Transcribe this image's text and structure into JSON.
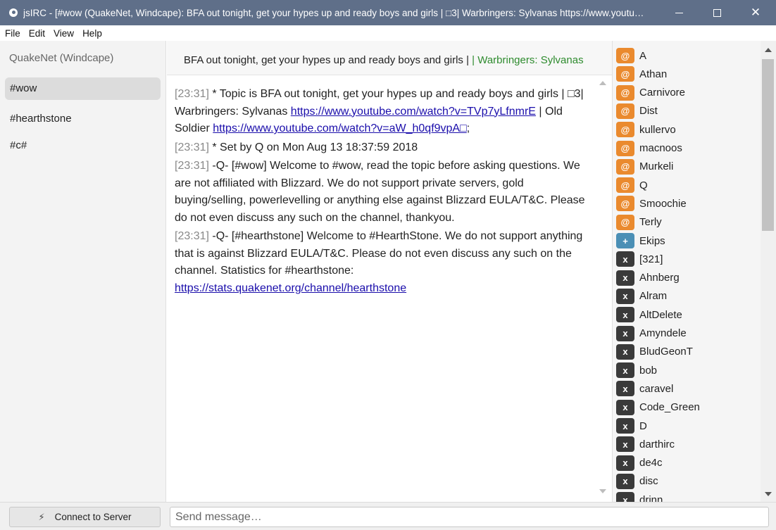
{
  "window": {
    "title": "jsIRC - [#wow (QuakeNet, Windcape): BFA out tonight, get your hypes up and ready boys and girls | □3| Warbringers: Sylvanas https://www.youtu…"
  },
  "menu": [
    "File",
    "Edit",
    "View",
    "Help"
  ],
  "sidebar": {
    "server": "QuakeNet (Windcape)",
    "channels": [
      "#wow",
      "#hearthstone",
      "#c#"
    ]
  },
  "topic": {
    "text": "BFA out tonight, get your hypes up and ready boys and girls |",
    "colored": "| Warbringers: Sylvanas"
  },
  "messages": [
    {
      "time": "[23:31]",
      "text": " * Topic is BFA out tonight, get your hypes up and ready boys and girls | □3| Warbringers: Sylvanas ",
      "link1": "https://www.youtube.com/watch?v=TVp7yLfnmrE",
      "mid": " | Old Soldier ",
      "link2": "https://www.youtube.com/watch?v=aW_h0qf9vpA□",
      "end": ";"
    },
    {
      "time": "[23:31]",
      "text": " * Set by Q on Mon Aug 13 18:37:59 2018"
    },
    {
      "time": "[23:31]",
      "text": " -Q- [#wow] Welcome to #wow, read the topic before asking questions. We are not affiliated with Blizzard. We do not support private servers, gold buying/selling, powerlevelling or anything else against Blizzard EULA/T&C. Please do not even discuss any such on the channel, thankyou."
    },
    {
      "time": "[23:31]",
      "text": " -Q- [#hearthstone] Welcome to #HearthStone. We do not support anything that is against Blizzard EULA/T&C. Please do not even discuss any such on the channel. Statistics for #hearthstone: ",
      "link1": "https://stats.quakenet.org/channel/hearthstone"
    }
  ],
  "users": [
    {
      "prefix": "@",
      "name": "A",
      "type": "op"
    },
    {
      "prefix": "@",
      "name": "Athan",
      "type": "op"
    },
    {
      "prefix": "@",
      "name": "Carnivore",
      "type": "op"
    },
    {
      "prefix": "@",
      "name": "Dist",
      "type": "op"
    },
    {
      "prefix": "@",
      "name": "kullervo",
      "type": "op"
    },
    {
      "prefix": "@",
      "name": "macnoos",
      "type": "op"
    },
    {
      "prefix": "@",
      "name": "Murkeli",
      "type": "op"
    },
    {
      "prefix": "@",
      "name": "Q",
      "type": "op"
    },
    {
      "prefix": "@",
      "name": "Smoochie",
      "type": "op"
    },
    {
      "prefix": "@",
      "name": "Terly",
      "type": "op"
    },
    {
      "prefix": "+",
      "name": "Ekips",
      "type": "voice"
    },
    {
      "prefix": "x",
      "name": "[321]",
      "type": "none"
    },
    {
      "prefix": "x",
      "name": "Ahnberg",
      "type": "none"
    },
    {
      "prefix": "x",
      "name": "Alram",
      "type": "none"
    },
    {
      "prefix": "x",
      "name": "AltDelete",
      "type": "none"
    },
    {
      "prefix": "x",
      "name": "Amyndele",
      "type": "none"
    },
    {
      "prefix": "x",
      "name": "BludGeonT",
      "type": "none"
    },
    {
      "prefix": "x",
      "name": "bob",
      "type": "none"
    },
    {
      "prefix": "x",
      "name": "caravel",
      "type": "none"
    },
    {
      "prefix": "x",
      "name": "Code_Green",
      "type": "none"
    },
    {
      "prefix": "x",
      "name": "D",
      "type": "none"
    },
    {
      "prefix": "x",
      "name": "darthirc",
      "type": "none"
    },
    {
      "prefix": "x",
      "name": "de4c",
      "type": "none"
    },
    {
      "prefix": "x",
      "name": "disc",
      "type": "none"
    },
    {
      "prefix": "x",
      "name": "drinn",
      "type": "none"
    }
  ],
  "bottom": {
    "connect_label": "Connect to Server",
    "input_placeholder": "Send message…"
  },
  "colors": {
    "titlebar": "#5f6f89",
    "op_badge": "#ea8a2e",
    "voice_badge": "#4b8fb5",
    "user_badge": "#3a3a3a",
    "topic_green": "#2e8b2e",
    "link": "#1a0dab"
  }
}
